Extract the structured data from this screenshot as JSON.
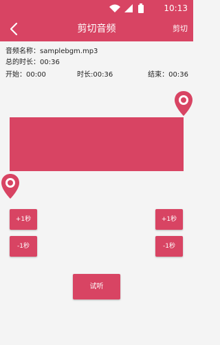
{
  "statusbar": {
    "time": "10:13"
  },
  "toolbar": {
    "title": "剪切音频",
    "action_label": "剪切"
  },
  "info": {
    "name_label": "音频名称：",
    "name_value": "samplebgm.mp3",
    "total_label": "总的时长：",
    "total_value": "00:36",
    "start_label": "开始：",
    "start_value": "00:00",
    "length_label": "时长:",
    "length_value": "00:36",
    "end_label": "结束：",
    "end_value": "00:36"
  },
  "controls": {
    "left_plus": "+1秒",
    "left_minus": "-1秒",
    "right_plus": "+1秒",
    "right_minus": "-1秒",
    "try_listen": "试听"
  },
  "colors": {
    "accent": "#d84463"
  },
  "icons": [
    "back-arrow-icon",
    "location-pin-icon",
    "wifi-icon",
    "battery-icon",
    "signal-icon"
  ]
}
